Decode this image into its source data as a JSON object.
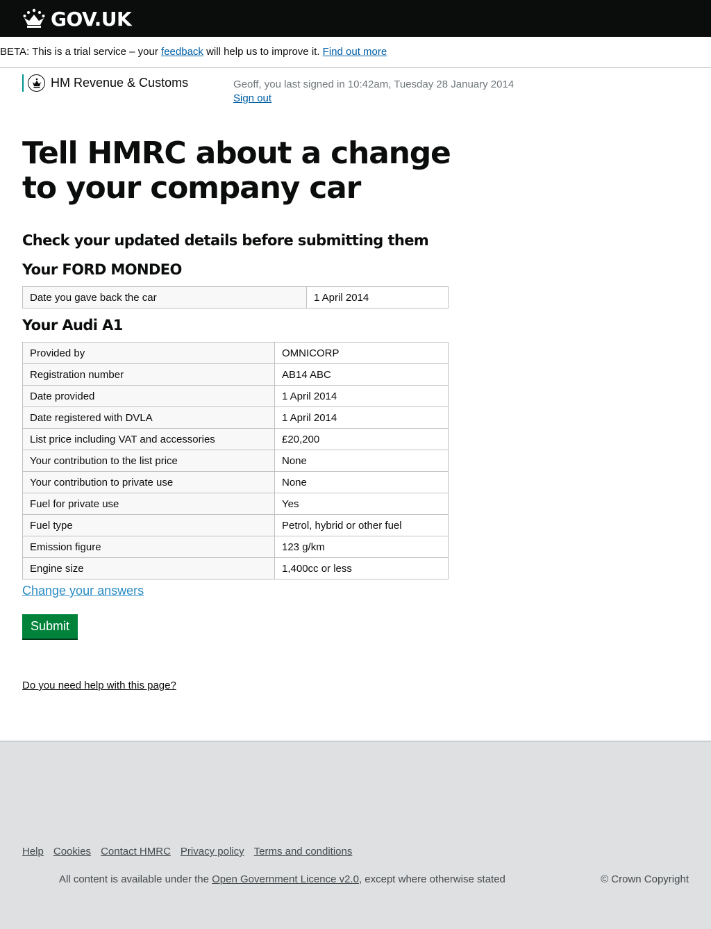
{
  "header": {
    "logo_text": "GOV.UK"
  },
  "beta_banner": {
    "text_before": "BETA: This is a trial service – your ",
    "feedback_link": "feedback",
    "text_after": " will help us to improve it. ",
    "find_out_more_link": "Find out more"
  },
  "department": {
    "name": "HM Revenue & Customs"
  },
  "signin": {
    "last_signed_in": "Geoff, you last signed in 10:42am, Tuesday 28 January 2014",
    "sign_out_link": "Sign out"
  },
  "page_title": "Tell HMRC about a change to your company car",
  "check_heading": "Check your updated details before submitting them",
  "old_car": {
    "heading": "Your FORD MONDEO",
    "rows": [
      {
        "label": "Date you gave back the car",
        "value": "1 April 2014"
      }
    ]
  },
  "new_car": {
    "heading": "Your Audi A1",
    "rows": [
      {
        "label": "Provided by",
        "value": "OMNICORP"
      },
      {
        "label": "Registration number",
        "value": "AB14 ABC"
      },
      {
        "label": "Date provided",
        "value": "1 April 2014"
      },
      {
        "label": "Date registered with DVLA",
        "value": "1 April 2014"
      },
      {
        "label": "List price including VAT and accessories",
        "value": "£20,200"
      },
      {
        "label": "Your contribution to the list price",
        "value": "None"
      },
      {
        "label": "Your contribution to private use",
        "value": "None"
      },
      {
        "label": "Fuel for private use",
        "value": "Yes"
      },
      {
        "label": "Fuel type",
        "value": "Petrol, hybrid or other fuel"
      },
      {
        "label": "Emission figure",
        "value": "123 g/km"
      },
      {
        "label": "Engine size",
        "value": "1,400cc or less"
      }
    ]
  },
  "actions": {
    "change_answers_link": "Change your answers",
    "submit_label": "Submit",
    "help_link": "Do you need help with this page?"
  },
  "footer": {
    "links": [
      "Help",
      "Cookies",
      "Contact HMRC",
      "Privacy policy",
      "Terms and conditions"
    ],
    "licence_before": "All content is available under the ",
    "licence_link": "Open Government Licence v2.0",
    "licence_after": ", except where otherwise stated",
    "copyright": "© Crown Copyright"
  },
  "colors": {
    "header_bg": "#0b0c0c",
    "link": "#005ea5",
    "submit_green": "#00823b",
    "footer_bg": "#dee0e2",
    "brand_teal": "#009390"
  },
  "icons": {
    "logo": "crown-icon",
    "department": "royal-crest-icon"
  }
}
